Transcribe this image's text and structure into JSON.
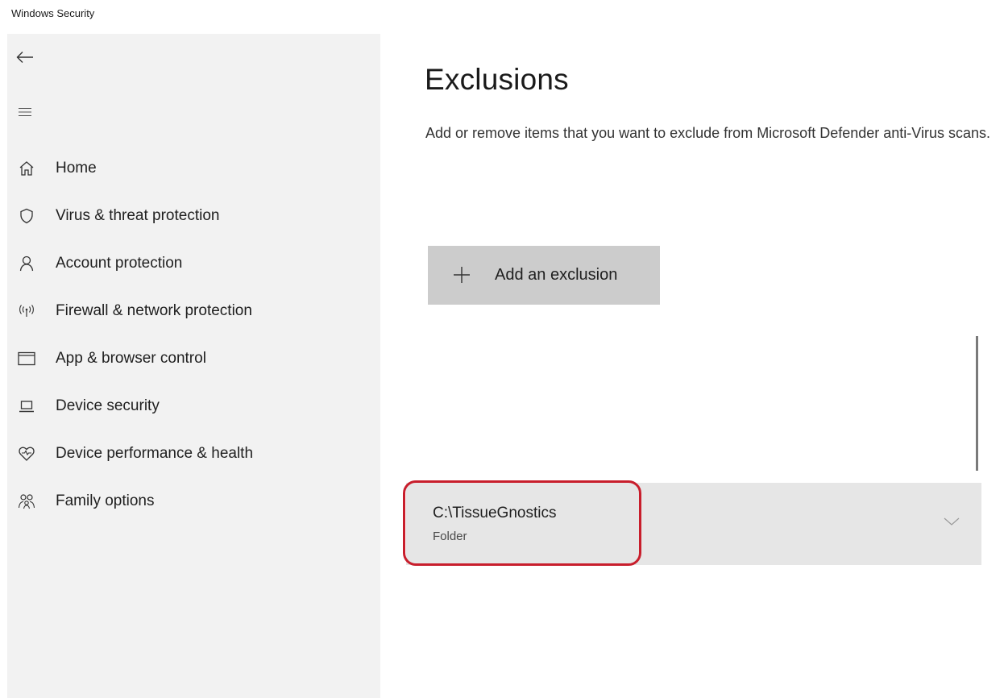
{
  "window": {
    "title": "Windows Security"
  },
  "sidebar": {
    "items": [
      {
        "label": "Home",
        "icon": "home-icon"
      },
      {
        "label": "Virus & threat protection",
        "icon": "shield-icon"
      },
      {
        "label": "Account protection",
        "icon": "person-icon"
      },
      {
        "label": "Firewall & network protection",
        "icon": "wireless-icon"
      },
      {
        "label": "App & browser control",
        "icon": "browser-window-icon"
      },
      {
        "label": "Device security",
        "icon": "laptop-icon"
      },
      {
        "label": "Device performance & health",
        "icon": "heart-pulse-icon"
      },
      {
        "label": "Family options",
        "icon": "family-icon"
      }
    ]
  },
  "main": {
    "title": "Exclusions",
    "description": "Add or remove items that you want to exclude from Microsoft Defender anti-Virus scans.",
    "add_button_label": "Add an exclusion",
    "exclusions": [
      {
        "path": "C:\\TissueGnostics",
        "type": "Folder"
      }
    ]
  },
  "colors": {
    "sidebar_bg": "#f2f2f2",
    "button_bg": "#cccccc",
    "row_bg": "#e6e6e6",
    "highlight": "#c81e2c"
  }
}
